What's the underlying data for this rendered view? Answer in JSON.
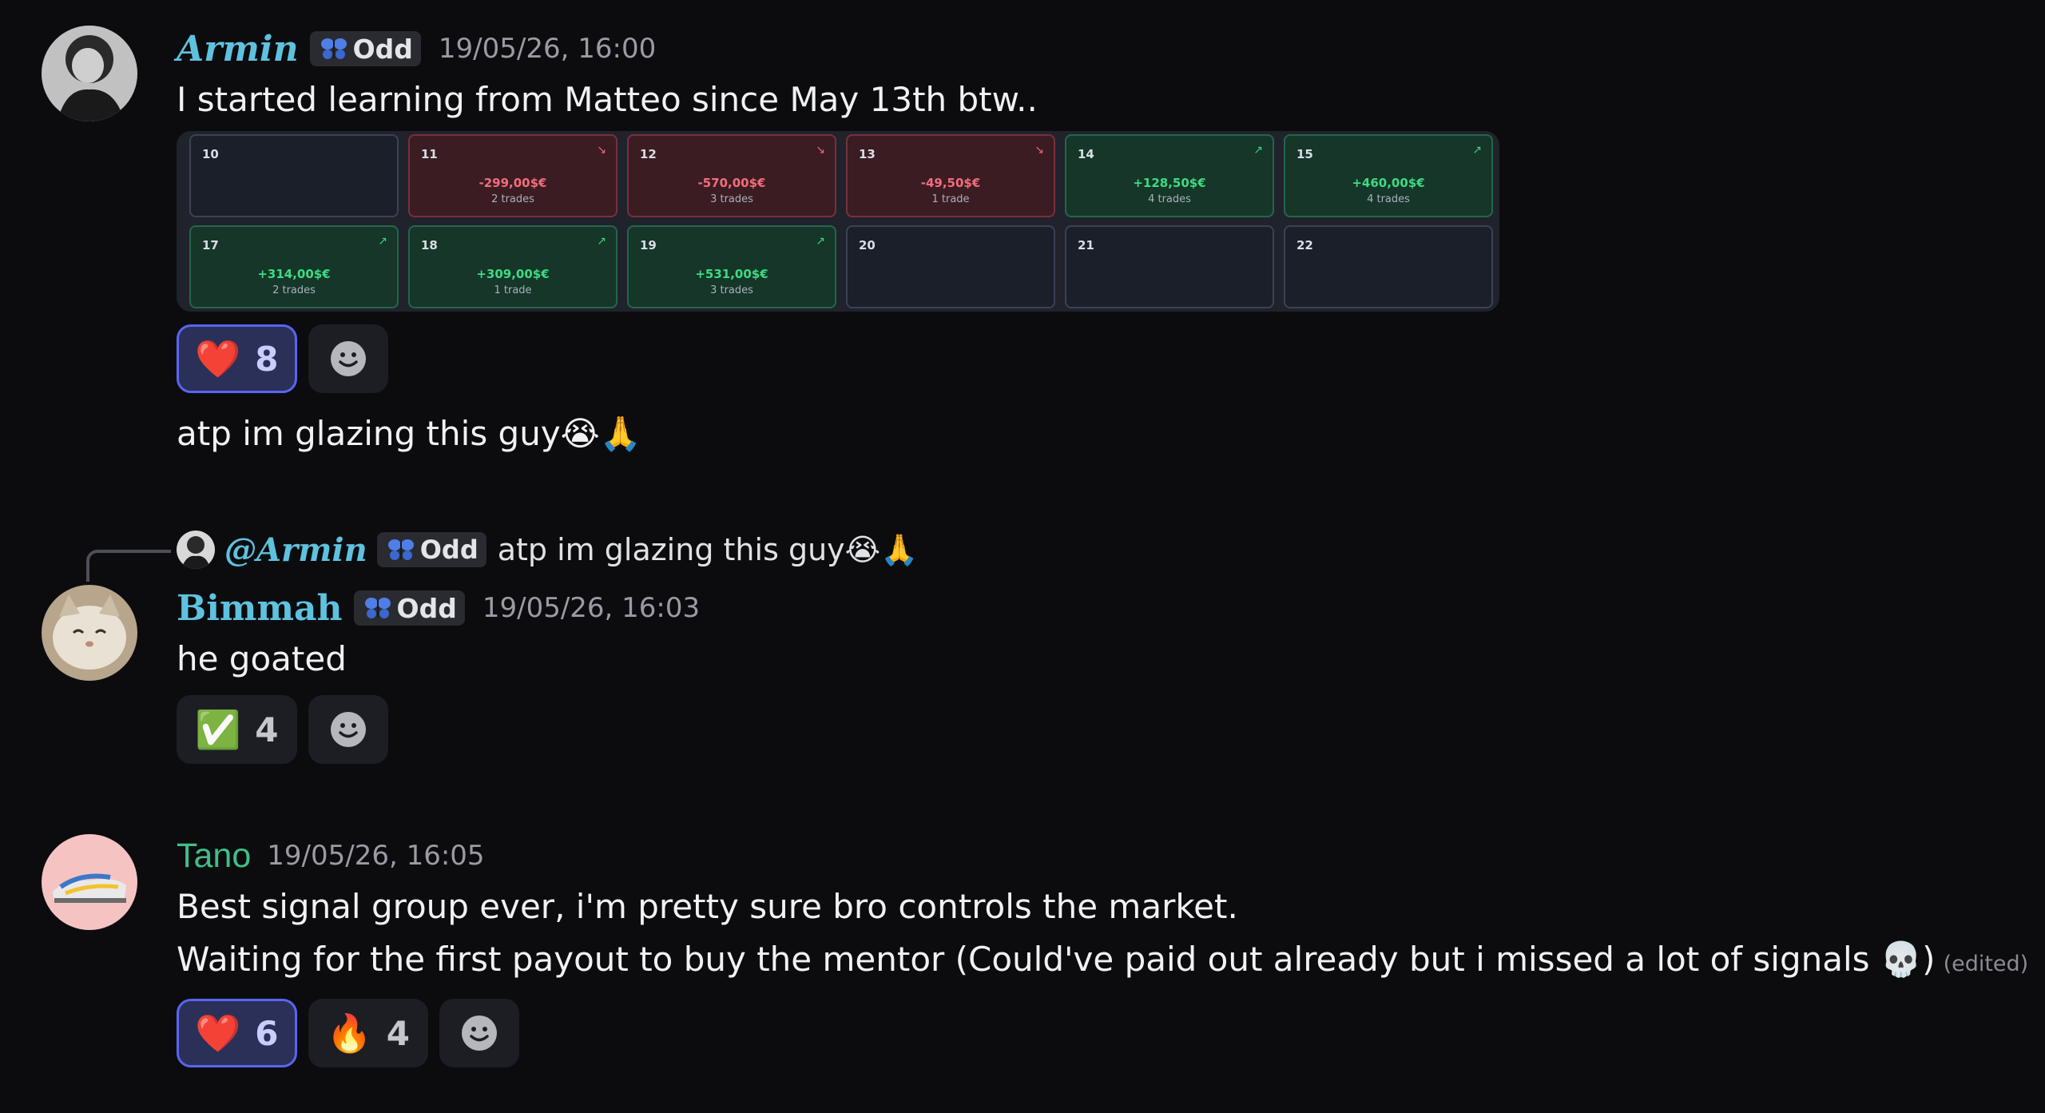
{
  "messages": [
    {
      "author": "Armin",
      "tag": "Odd",
      "timestamp": "19/05/26, 16:00",
      "text": "I started learning from Matteo since May 13th btw..",
      "calendar": [
        {
          "day": "10",
          "amount": "",
          "trades": "",
          "status": "empty"
        },
        {
          "day": "11",
          "amount": "-299,00$€",
          "trades": "2 trades",
          "status": "loss"
        },
        {
          "day": "12",
          "amount": "-570,00$€",
          "trades": "3 trades",
          "status": "loss"
        },
        {
          "day": "13",
          "amount": "-49,50$€",
          "trades": "1 trade",
          "status": "loss"
        },
        {
          "day": "14",
          "amount": "+128,50$€",
          "trades": "4 trades",
          "status": "win"
        },
        {
          "day": "15",
          "amount": "+460,00$€",
          "trades": "4 trades",
          "status": "win"
        },
        {
          "day": "17",
          "amount": "+314,00$€",
          "trades": "2 trades",
          "status": "win"
        },
        {
          "day": "18",
          "amount": "+309,00$€",
          "trades": "1 trade",
          "status": "win"
        },
        {
          "day": "19",
          "amount": "+531,00$€",
          "trades": "3 trades",
          "status": "win"
        },
        {
          "day": "20",
          "amount": "",
          "trades": "",
          "status": "empty"
        },
        {
          "day": "21",
          "amount": "",
          "trades": "",
          "status": "empty"
        },
        {
          "day": "22",
          "amount": "",
          "trades": "",
          "status": "empty"
        }
      ],
      "reactions": [
        {
          "emoji": "❤️",
          "count": "8",
          "active": true
        }
      ],
      "followup": "atp im glazing this guy😭🙏"
    },
    {
      "reply": {
        "mention": "@Armin",
        "tag": "Odd",
        "text": "atp im glazing this guy😭🙏"
      },
      "author": "Bimmah",
      "tag": "Odd",
      "timestamp": "19/05/26, 16:03",
      "text": "he goated",
      "reactions": [
        {
          "emoji": "✅",
          "count": "4",
          "active": false
        }
      ]
    },
    {
      "author": "Tano",
      "timestamp": "19/05/26, 16:05",
      "lines": [
        "Best signal group ever, i'm pretty sure bro controls the market.",
        "Waiting for the first payout to buy the mentor (Could've paid out already but i missed a lot of signals 💀)"
      ],
      "edited": "(edited)",
      "reactions": [
        {
          "emoji": "❤️",
          "count": "6",
          "active": true
        },
        {
          "emoji": "🔥",
          "count": "4",
          "active": false
        }
      ]
    }
  ],
  "colors": {
    "background": "#0c0c0f",
    "fancy_name": "#5ec2df",
    "tano_name": "#3fbf88",
    "active_reaction": "#5865f2",
    "loss": "#f26e7a",
    "win": "#3edb82"
  },
  "icons": [
    "butterfly-icon",
    "add-reaction-icon",
    "trend-up-icon",
    "trend-down-icon"
  ]
}
